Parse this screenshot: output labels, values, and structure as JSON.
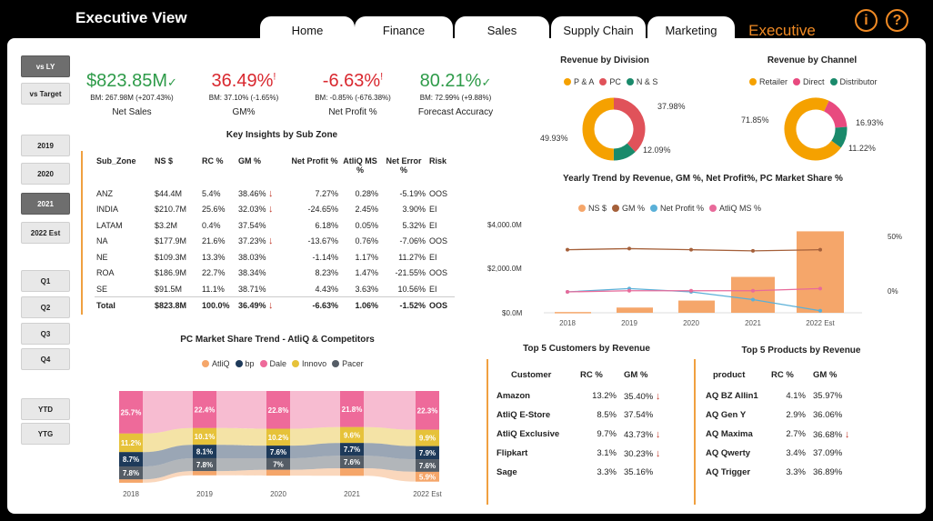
{
  "app": {
    "title": "Executive View"
  },
  "tabs": [
    {
      "label": "Home"
    },
    {
      "label": "Finance"
    },
    {
      "label": "Sales"
    },
    {
      "label": "Supply Chain"
    },
    {
      "label": "Marketing"
    }
  ],
  "active_tab": "Executive",
  "icons": {
    "info": "i",
    "help": "?"
  },
  "slicers": {
    "compare": [
      {
        "label": "vs LY",
        "selected": true
      },
      {
        "label": "vs Target",
        "selected": false
      }
    ],
    "years": [
      {
        "label": "2019"
      },
      {
        "label": "2020"
      },
      {
        "label": "2021",
        "selected": true
      },
      {
        "label": "2022 Est"
      }
    ],
    "quarters": [
      {
        "label": "Q1"
      },
      {
        "label": "Q2"
      },
      {
        "label": "Q3"
      },
      {
        "label": "Q4"
      }
    ],
    "periods": [
      {
        "label": "YTD"
      },
      {
        "label": "YTG"
      }
    ]
  },
  "kpis": [
    {
      "value": "$823.85M",
      "mark": "✓",
      "bm": "BM: 267.98M (+207.43%)",
      "label": "Net Sales",
      "status": "good"
    },
    {
      "value": "36.49%",
      "mark": "!",
      "bm": "BM: 37.10% (-1.65%)",
      "label": "GM%",
      "status": "bad"
    },
    {
      "value": "-6.63%",
      "mark": "!",
      "bm": "BM: -0.85% (-676.38%)",
      "label": "Net Profit %",
      "status": "bad"
    },
    {
      "value": "80.21%",
      "mark": "✓",
      "bm": "BM: 72.99% (+9.88%)",
      "label": "Forecast Accuracy",
      "status": "good"
    }
  ],
  "key_insights": {
    "title": "Key Insights by Sub Zone",
    "headers": [
      "Sub_Zone",
      "NS $",
      "RC %",
      "GM %",
      "Net Profit %",
      "AtliQ MS %",
      "Net Error %",
      "Risk"
    ],
    "rows": [
      {
        "zone": "ANZ",
        "ns": "$44.4M",
        "rc": "5.4%",
        "gm": "38.46%",
        "down": true,
        "np": "7.27%",
        "ms": "0.28%",
        "ne": "-5.19%",
        "risk": "OOS"
      },
      {
        "zone": "INDIA",
        "ns": "$210.7M",
        "rc": "25.6%",
        "gm": "32.03%",
        "down": true,
        "np": "-24.65%",
        "ms": "2.45%",
        "ne": "3.90%",
        "risk": "EI"
      },
      {
        "zone": "LATAM",
        "ns": "$3.2M",
        "rc": "0.4%",
        "gm": "37.54%",
        "down": false,
        "np": "6.18%",
        "ms": "0.05%",
        "ne": "5.32%",
        "risk": "EI"
      },
      {
        "zone": "NA",
        "ns": "$177.9M",
        "rc": "21.6%",
        "gm": "37.23%",
        "down": true,
        "np": "-13.67%",
        "ms": "0.76%",
        "ne": "-7.06%",
        "risk": "OOS"
      },
      {
        "zone": "NE",
        "ns": "$109.3M",
        "rc": "13.3%",
        "gm": "38.03%",
        "down": false,
        "np": "-1.14%",
        "ms": "1.17%",
        "ne": "11.27%",
        "risk": "EI"
      },
      {
        "zone": "ROA",
        "ns": "$186.9M",
        "rc": "22.7%",
        "gm": "38.34%",
        "down": false,
        "np": "8.23%",
        "ms": "1.47%",
        "ne": "-21.55%",
        "risk": "OOS"
      },
      {
        "zone": "SE",
        "ns": "$91.5M",
        "rc": "11.1%",
        "gm": "38.71%",
        "down": false,
        "np": "4.43%",
        "ms": "3.63%",
        "ne": "10.56%",
        "risk": "EI"
      }
    ],
    "total": {
      "zone": "Total",
      "ns": "$823.8M",
      "rc": "100.0%",
      "gm": "36.49%",
      "down": true,
      "np": "-6.63%",
      "ms": "1.06%",
      "ne": "-1.52%",
      "risk": "OOS"
    }
  },
  "revenue_by_division": {
    "title": "Revenue by Division",
    "legend": [
      {
        "name": "P & A",
        "color": "#f5a100"
      },
      {
        "name": "PC",
        "color": "#e0525a"
      },
      {
        "name": "N & S",
        "color": "#1a8a6b"
      }
    ],
    "labels": [
      "37.98%",
      "12.09%",
      "49.93%"
    ]
  },
  "revenue_by_channel": {
    "title": "Revenue by Channel",
    "legend": [
      {
        "name": "Retailer",
        "color": "#f5a100"
      },
      {
        "name": "Direct",
        "color": "#e84a7f"
      },
      {
        "name": "Distributor",
        "color": "#1a8a6b"
      }
    ],
    "labels": [
      "71.85%",
      "16.93%",
      "11.22%"
    ]
  },
  "yearly_trend": {
    "title": "Yearly Trend by Revenue, GM %, Net Profit%, PC Market Share %",
    "legend": [
      {
        "name": "NS $",
        "color": "#f5a66a"
      },
      {
        "name": "GM %",
        "color": "#a5603a"
      },
      {
        "name": "Net Profit %",
        "color": "#5ab0d8"
      },
      {
        "name": "AtliQ MS %",
        "color": "#e86a9a"
      }
    ],
    "y_left_ticks": [
      "$4,000.0M",
      "$2,000.0M",
      "$0.0M"
    ],
    "y_right_ticks": [
      "50%",
      "0%"
    ]
  },
  "market_share": {
    "title": "PC Market Share Trend - AtliQ & Competitors",
    "legend": [
      {
        "name": "AtliQ",
        "color": "#f5a66a"
      },
      {
        "name": "bp",
        "color": "#1e3a5a"
      },
      {
        "name": "Dale",
        "color": "#ee6a9a"
      },
      {
        "name": "Innovo",
        "color": "#e6c23a"
      },
      {
        "name": "Pacer",
        "color": "#555d66"
      }
    ]
  },
  "top_customers": {
    "title": "Top 5 Customers by Revenue",
    "headers": [
      "Customer",
      "RC %",
      "GM %"
    ],
    "rows": [
      {
        "name": "Amazon",
        "rc": "13.2%",
        "gm": "35.40%",
        "down": true
      },
      {
        "name": "AtliQ E-Store",
        "rc": "8.5%",
        "gm": "37.54%",
        "down": false
      },
      {
        "name": "AtliQ Exclusive",
        "rc": "9.7%",
        "gm": "43.73%",
        "down": true
      },
      {
        "name": "Flipkart",
        "rc": "3.1%",
        "gm": "30.23%",
        "down": true
      },
      {
        "name": "Sage",
        "rc": "3.3%",
        "gm": "35.16%",
        "down": false
      }
    ]
  },
  "top_products": {
    "title": "Top 5 Products by Revenue",
    "headers": [
      "product",
      "RC %",
      "GM %"
    ],
    "rows": [
      {
        "name": "AQ BZ Allin1",
        "rc": "4.1%",
        "gm": "35.97%",
        "down": false
      },
      {
        "name": "AQ Gen Y",
        "rc": "2.9%",
        "gm": "36.06%",
        "down": false
      },
      {
        "name": "AQ Maxima",
        "rc": "2.7%",
        "gm": "36.68%",
        "down": true
      },
      {
        "name": "AQ Qwerty",
        "rc": "3.4%",
        "gm": "37.09%",
        "down": false
      },
      {
        "name": "AQ Trigger",
        "rc": "3.3%",
        "gm": "36.89%",
        "down": false
      }
    ]
  },
  "chart_data": [
    {
      "type": "pie",
      "title": "Revenue by Division",
      "categories": [
        "P & A",
        "PC",
        "N & S"
      ],
      "values": [
        49.93,
        37.98,
        12.09
      ]
    },
    {
      "type": "pie",
      "title": "Revenue by Channel",
      "categories": [
        "Retailer",
        "Direct",
        "Distributor"
      ],
      "values": [
        71.85,
        16.93,
        11.22
      ]
    },
    {
      "type": "bar",
      "title": "Yearly Trend by Revenue, GM %, Net Profit%, PC Market Share %",
      "categories": [
        "2018",
        "2019",
        "2020",
        "2021",
        "2022 Est"
      ],
      "series": [
        {
          "name": "NS $",
          "values": [
            40,
            270,
            630,
            1850,
            4200
          ]
        },
        {
          "name": "GM %",
          "values": [
            38,
            39,
            38,
            37,
            38
          ]
        },
        {
          "name": "Net Profit %",
          "values": [
            0,
            3,
            0,
            -7,
            -17
          ]
        },
        {
          "name": "AtliQ MS %",
          "values": [
            0,
            1,
            1,
            1,
            3
          ]
        }
      ],
      "ylim": [
        0,
        4500
      ]
    },
    {
      "type": "area",
      "title": "PC Market Share Trend - AtliQ & Competitors",
      "categories": [
        "2018",
        "2019",
        "2020",
        "2021",
        "2022 Est"
      ],
      "series": [
        {
          "name": "Dale",
          "values": [
            25.7,
            22.4,
            22.8,
            21.8,
            22.3
          ]
        },
        {
          "name": "Innovo",
          "values": [
            11.2,
            10.1,
            10.2,
            9.6,
            9.9
          ]
        },
        {
          "name": "bp",
          "values": [
            8.7,
            8.1,
            7.6,
            7.7,
            7.9
          ]
        },
        {
          "name": "Pacer",
          "values": [
            7.8,
            7.8,
            7.0,
            7.6,
            7.6
          ]
        },
        {
          "name": "AtliQ",
          "values": [
            2.0,
            2.5,
            3.5,
            4.5,
            5.9
          ]
        }
      ]
    }
  ]
}
